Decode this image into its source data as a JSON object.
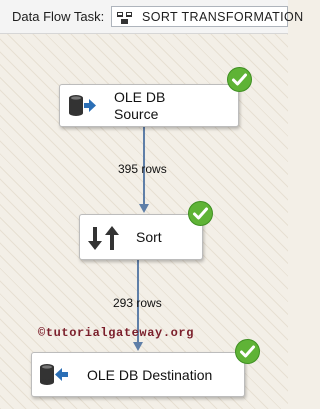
{
  "toolbar": {
    "task_label": "Data Flow Task:",
    "selected_task": "SORT TRANSFORMATION",
    "task_icon": "data-flow-task-icon"
  },
  "components": [
    {
      "line1": "OLE DB",
      "line2": "Source",
      "icon": "ole-db-source-icon",
      "status": "success"
    },
    {
      "label": "Sort",
      "icon": "sort-icon",
      "status": "success"
    },
    {
      "label": "OLE DB Destination",
      "icon": "ole-db-destination-icon",
      "status": "success"
    }
  ],
  "paths": [
    {
      "rows_label": "395 rows"
    },
    {
      "rows_label": "293 rows"
    }
  ],
  "watermark": "©tutorialgateway.org",
  "colors": {
    "success": "#5fb336",
    "path": "#5f7fa8"
  }
}
